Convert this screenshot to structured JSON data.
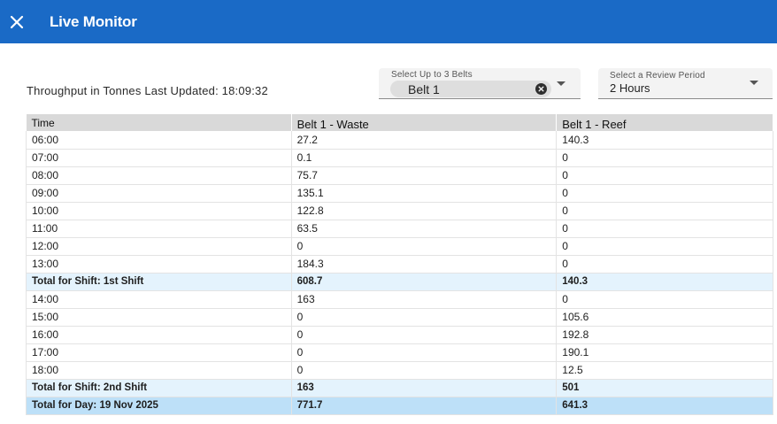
{
  "app": {
    "title": "Live Monitor"
  },
  "status": {
    "text": "Throughput in Tonnes Last Updated: 18:09:32"
  },
  "belt_select": {
    "label": "Select Up to 3 Belts",
    "chips": [
      "Belt 1"
    ]
  },
  "period_select": {
    "label": "Select a Review Period",
    "value": "2 Hours"
  },
  "table": {
    "headers": [
      "Time",
      "Belt 1 - Waste",
      "Belt 1 - Reef"
    ],
    "rows": [
      {
        "type": "hour",
        "cells": [
          "06:00",
          "27.2",
          "140.3"
        ]
      },
      {
        "type": "hour",
        "cells": [
          "07:00",
          "0.1",
          "0"
        ]
      },
      {
        "type": "hour",
        "cells": [
          "08:00",
          "75.7",
          "0"
        ]
      },
      {
        "type": "hour",
        "cells": [
          "09:00",
          "135.1",
          "0"
        ]
      },
      {
        "type": "hour",
        "cells": [
          "10:00",
          "122.8",
          "0"
        ]
      },
      {
        "type": "hour",
        "cells": [
          "11:00",
          "63.5",
          "0"
        ]
      },
      {
        "type": "hour",
        "cells": [
          "12:00",
          "0",
          "0"
        ]
      },
      {
        "type": "hour",
        "cells": [
          "13:00",
          "184.3",
          "0"
        ]
      },
      {
        "type": "shift",
        "cells": [
          "Total for Shift: 1st Shift",
          "608.7",
          "140.3"
        ]
      },
      {
        "type": "hour",
        "cells": [
          "14:00",
          "163",
          "0"
        ]
      },
      {
        "type": "hour",
        "cells": [
          "15:00",
          "0",
          "105.6"
        ]
      },
      {
        "type": "hour",
        "cells": [
          "16:00",
          "0",
          "192.8"
        ]
      },
      {
        "type": "hour",
        "cells": [
          "17:00",
          "0",
          "190.1"
        ]
      },
      {
        "type": "hour",
        "cells": [
          "18:00",
          "0",
          "12.5"
        ]
      },
      {
        "type": "shift",
        "cells": [
          "Total for Shift: 2nd Shift",
          "163",
          "501"
        ]
      },
      {
        "type": "day",
        "cells": [
          "Total for Day: 19 Nov 2025",
          "771.7",
          "641.3"
        ]
      }
    ]
  },
  "icons": {
    "close": "close-icon",
    "chip_remove": "cancel-circle-icon",
    "dropdown": "arrow-drop-down-icon"
  },
  "colors": {
    "appbar": "#1a6ac6",
    "shift_row": "#e4f3fd",
    "day_row": "#bde0f8",
    "header_row": "#d9d9d9"
  }
}
